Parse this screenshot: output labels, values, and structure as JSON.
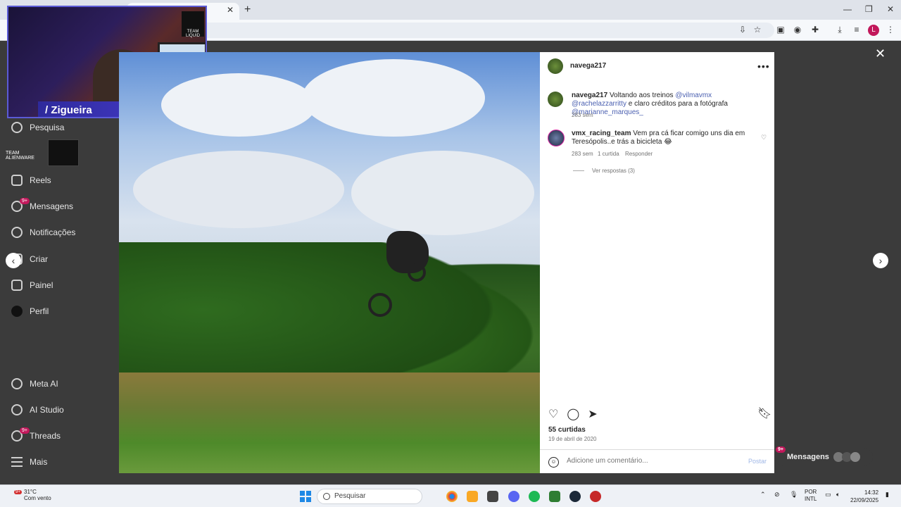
{
  "sidebar": {
    "items": [
      {
        "label": "Pesquisa"
      },
      {
        "label": "Reels"
      },
      {
        "label": "Mensagens",
        "badge": "9+"
      },
      {
        "label": "Notificações"
      },
      {
        "label": "Criar"
      },
      {
        "label": "Painel"
      },
      {
        "label": "Perfil"
      },
      {
        "label": "Meta AI"
      },
      {
        "label": "AI Studio"
      },
      {
        "label": "Threads",
        "badge": "9+"
      },
      {
        "label": "Mais"
      }
    ]
  },
  "overlay": {
    "streamer_name": "/ Zigueira",
    "team_logo_text": "TEAM LIQUID",
    "sponsor_text": "TEAM ALIENWARE"
  },
  "post": {
    "author": "navega217",
    "caption_user": "navega217",
    "caption_text": "Voltando aos treinos",
    "mention1": "@vilmavmx",
    "mention2": "@rachelazzarritty",
    "caption_text2": "e claro créditos para a fotógrafa",
    "mention3": "@marianne_marques_",
    "caption_age": "283 sem",
    "comment": {
      "user": "vmx_racing_team",
      "text": "Vem pra cá ficar comigo uns dia em Teresópolis..e trás a bicicleta 😂",
      "age": "283 sem",
      "likes": "1 curtida",
      "reply": "Responder",
      "view_replies": "Ver respostas (3)"
    },
    "likes": "55 curtidas",
    "date": "19 de abril de 2020",
    "comment_placeholder": "Adicione um comentário...",
    "post_button": "Postar"
  },
  "messages_pill": {
    "label": "Mensagens",
    "badge": "9+"
  },
  "taskbar": {
    "temperature": "31°C",
    "weather": "Com vento",
    "weather_badge": "9+",
    "search_label": "Pesquisar",
    "lang_top": "POR",
    "lang_bottom": "INTL",
    "time": "14:32",
    "date": "22/09/2025"
  },
  "colors": {
    "accent_link": "#4a5fb0",
    "badge": "#c2185b",
    "overlay_accent": "#4b3fd6"
  }
}
